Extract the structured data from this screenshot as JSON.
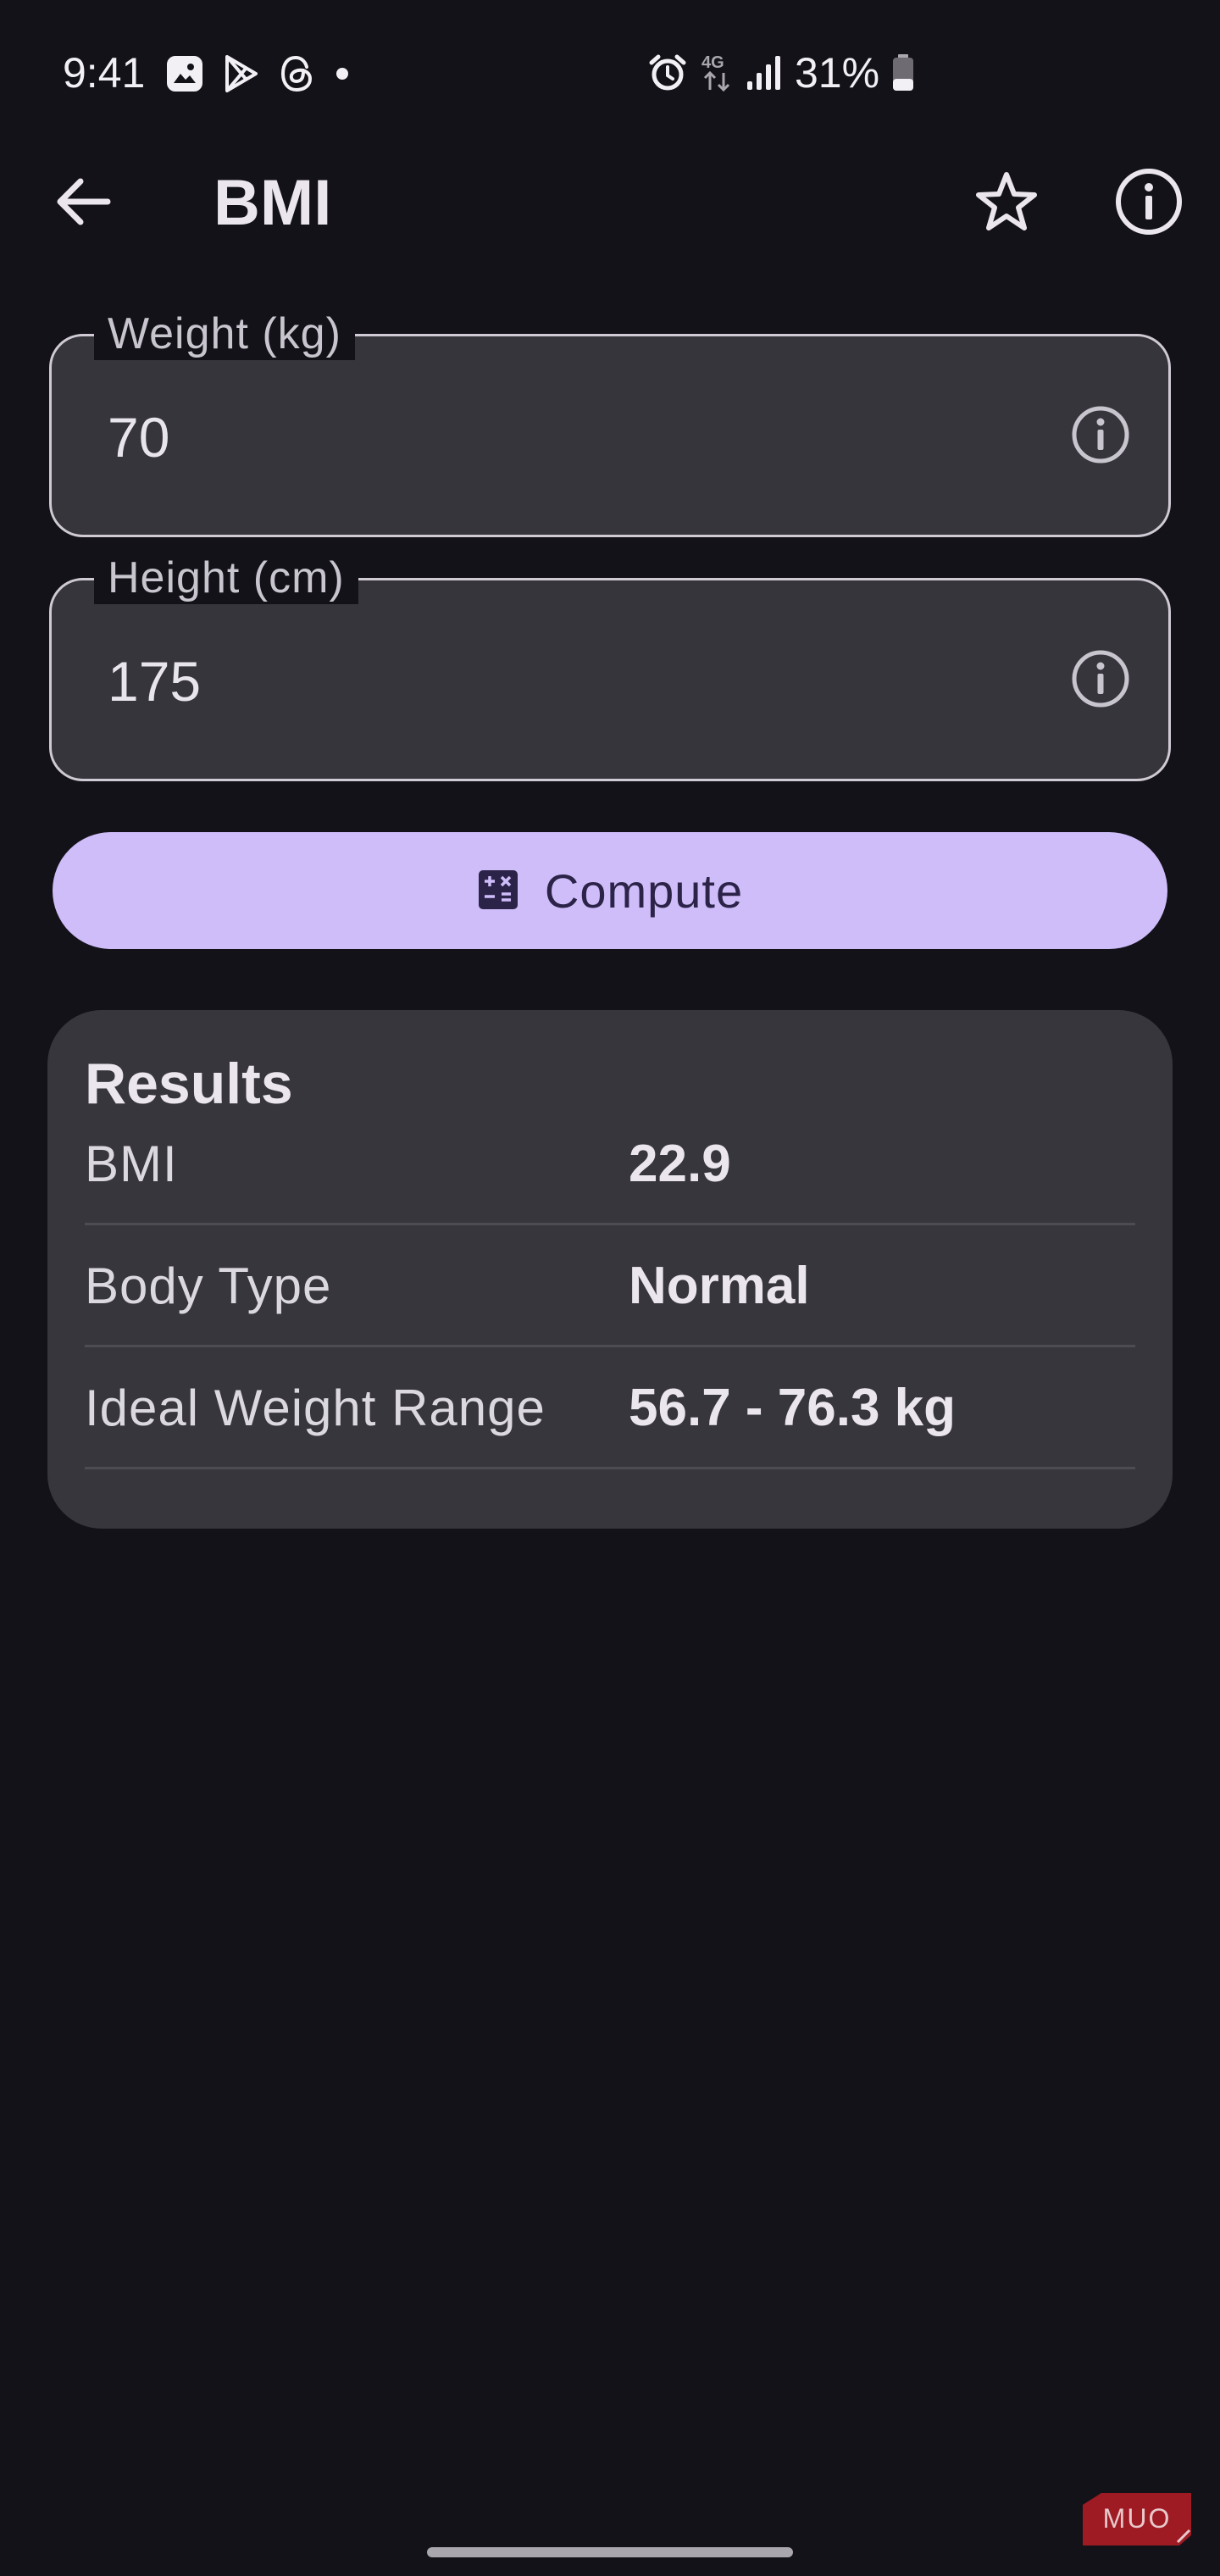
{
  "status_bar": {
    "time": "9:41",
    "left_icons": [
      "gallery-icon",
      "play-store-icon",
      "threads-icon",
      "dot-icon"
    ],
    "right_icons": [
      "alarm-icon",
      "network-4g-icon",
      "signal-icon",
      "battery-icon"
    ],
    "network_label": "4G",
    "battery_percent": "31%"
  },
  "app_bar": {
    "title": "BMI",
    "back_icon": "arrow-left-icon",
    "favorite_icon": "star-outline-icon",
    "info_icon": "info-icon"
  },
  "form": {
    "weight": {
      "label": "Weight (kg)",
      "value": "70"
    },
    "height": {
      "label": "Height (cm)",
      "value": "175"
    }
  },
  "compute_button": {
    "label": "Compute",
    "icon": "calculate-icon"
  },
  "results": {
    "title": "Results",
    "rows": [
      {
        "label": "BMI",
        "value": "22.9"
      },
      {
        "label": "Body Type",
        "value": "Normal"
      },
      {
        "label": "Ideal Weight Range",
        "value": "56.7 - 76.3 kg"
      }
    ]
  },
  "watermark": "MUO",
  "colors": {
    "background": "#131218",
    "surface": "#36353b",
    "primary_container": "#cfbdfa",
    "on_primary_container": "#2c2348",
    "watermark": "#9e1b24"
  }
}
